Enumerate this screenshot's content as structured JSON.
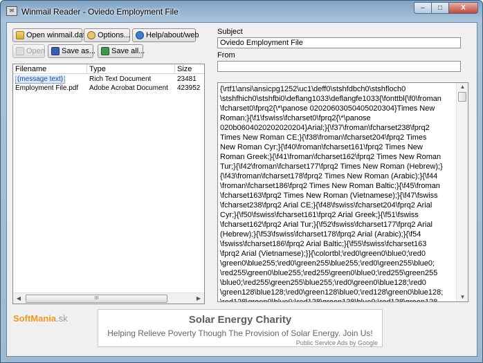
{
  "window": {
    "title": "Winmail Reader - Oviedo Employment File",
    "minimize_label": "–",
    "maximize_label": "□",
    "close_label": "X"
  },
  "toolbar": {
    "open_winmail_label": "Open winmail.dat",
    "options_label": "Options...",
    "help_label": "Help/about/web",
    "open_label": "Open",
    "save_as_label": "Save as...",
    "save_all_label": "Save all..."
  },
  "attachments": {
    "columns": [
      "Filename",
      "Type",
      "Size"
    ],
    "rows": [
      {
        "filename": "(message text)",
        "type": "Rich Text Document",
        "size": "23481"
      },
      {
        "filename": "Employment File.pdf",
        "type": "Adobe Acrobat Document",
        "size": "423952"
      }
    ],
    "scroll_grip": "III",
    "scroll_left": "◀",
    "scroll_right": "▶"
  },
  "message": {
    "subject_label": "Subject",
    "subject_value": "Oviedo Employment File",
    "from_label": "From",
    "from_value": "",
    "body_lines": [
      "{\\rtf1\\ansi\\ansicpg1252\\uc1\\deff0\\stshfdbch0\\stshfloch0",
      "\\stshfhich0\\stshfbi0\\deflang1033\\deflangfe1033{\\fonttbl{\\f0\\froman",
      "\\fcharset0\\fprq2{\\*\\panose 02020603050405020304}Times New",
      "Roman;}{\\f1\\fswiss\\fcharset0\\fprq2{\\*\\panose",
      "020b0604020202020204}Arial;}{\\f37\\froman\\fcharset238\\fprq2",
      "Times New Roman CE;}{\\f38\\froman\\fcharset204\\fprq2 Times",
      "New Roman Cyr;}{\\f40\\froman\\fcharset161\\fprq2 Times New",
      "Roman Greek;}{\\f41\\froman\\fcharset162\\fprq2 Times New Roman",
      "Tur;}{\\f42\\froman\\fcharset177\\fprq2 Times New Roman (Hebrew);}",
      "{\\f43\\froman\\fcharset178\\fprq2 Times New Roman (Arabic);}{\\f44",
      "\\froman\\fcharset186\\fprq2 Times New Roman Baltic;}{\\f45\\froman",
      "\\fcharset163\\fprq2 Times New Roman (Vietnamese);}{\\f47\\fswiss",
      "\\fcharset238\\fprq2 Arial CE;}{\\f48\\fswiss\\fcharset204\\fprq2 Arial",
      "Cyr;}{\\f50\\fswiss\\fcharset161\\fprq2 Arial Greek;}{\\f51\\fswiss",
      "\\fcharset162\\fprq2 Arial Tur;}{\\f52\\fswiss\\fcharset177\\fprq2 Arial",
      "(Hebrew);}{\\f53\\fswiss\\fcharset178\\fprq2 Arial (Arabic);}{\\f54",
      "\\fswiss\\fcharset186\\fprq2 Arial Baltic;}{\\f55\\fswiss\\fcharset163",
      "\\fprq2 Arial (Vietnamese);}}{\\colortbl;\\red0\\green0\\blue0;\\red0",
      "\\green0\\blue255;\\red0\\green255\\blue255;\\red0\\green255\\blue0;",
      "\\red255\\green0\\blue255;\\red255\\green0\\blue0;\\red255\\green255",
      "\\blue0;\\red255\\green255\\blue255;\\red0\\green0\\blue128;\\red0",
      "\\green128\\blue128;\\red0\\green128\\blue0;\\red128\\green0\\blue128;",
      "\\red128\\green0\\blue0;\\red128\\green128\\blue0;\\red128\\green128"
    ],
    "scroll_up": "▲",
    "scroll_down": "▼"
  },
  "ad": {
    "title": "Solar Energy Charity",
    "text": "Helping Relieve Poverty Though The Provision of Solar Energy. Join Us!",
    "footer": "Public Service Ads by Google"
  },
  "branding": {
    "logo_main": "SoftMania",
    "logo_suffix": ".sk"
  },
  "colors": {
    "title_bar": "#a7c2da",
    "selection": "#dbe8f7",
    "logo_accent": "#f29a1d"
  }
}
